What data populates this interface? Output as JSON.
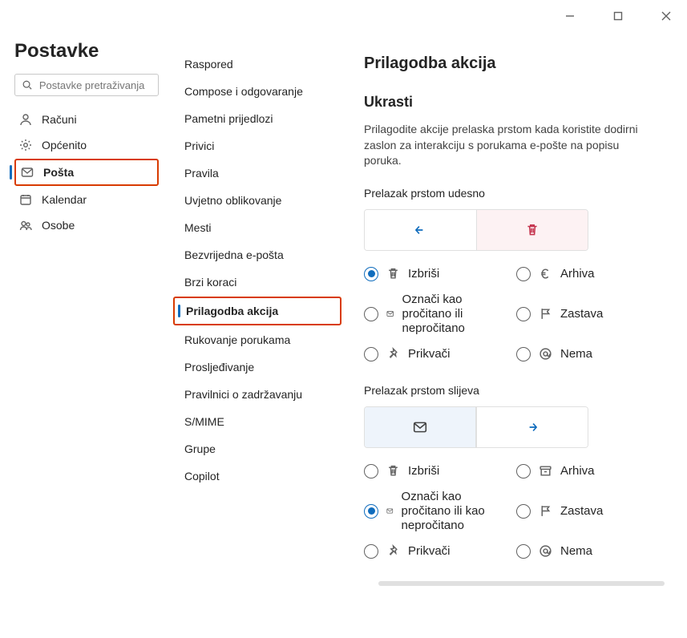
{
  "window": {
    "minimize": "–",
    "maximize": "▢",
    "close": "✕"
  },
  "sidebar": {
    "title": "Postavke",
    "search_placeholder": "Postavke pretraživanja",
    "items": [
      {
        "label": "Računi",
        "icon": "person"
      },
      {
        "label": "Općenito",
        "icon": "gear"
      },
      {
        "label": "Pošta",
        "icon": "mail",
        "selected": true,
        "callout": true
      },
      {
        "label": "Kalendar",
        "icon": "calendar"
      },
      {
        "label": "Osobe",
        "icon": "people"
      }
    ]
  },
  "subnav": {
    "items": [
      "Raspored",
      "Compose i odgovaranje",
      "Pametni prijedlozi",
      "Privici",
      "Pravila",
      "Uvjetno oblikovanje",
      "Mesti",
      "Bezvrijedna e-pošta",
      "Brzi koraci",
      "Prilagodba akcija",
      "Rukovanje porukama",
      "Prosljeđivanje",
      "Pravilnici o zadržavanju",
      "S/MIME",
      "Grupe",
      "Copilot"
    ],
    "selected_index": 9
  },
  "main": {
    "title": "Prilagodba akcija",
    "section_title": "Ukrasti",
    "description": "Prilagodite akcije prelaska prstom kada koristite dodirni zaslon za interakciju s porukama e-pošte na popisu poruka.",
    "swipe_right": {
      "label": "Prelazak prstom udesno",
      "preview": {
        "left_icon": "arrow-left",
        "right_icon": "trash",
        "right_bg": "pink"
      },
      "options": [
        {
          "icon": "trash",
          "label": "Izbriši",
          "selected": true
        },
        {
          "icon": "euro",
          "label": "Arhiva",
          "selected": false
        },
        {
          "icon": "mail",
          "label": "Označi kao pročitano ili nepročitano",
          "selected": false
        },
        {
          "icon": "flag",
          "label": "Zastava",
          "selected": false
        },
        {
          "icon": "pin",
          "label": "Prikvači",
          "selected": false
        },
        {
          "icon": "at",
          "label": "Nema",
          "selected": false
        }
      ]
    },
    "swipe_left": {
      "label": "Prelazak prstom slijeva",
      "preview": {
        "left_icon": "mail",
        "left_bg": "blue",
        "right_icon": "arrow-right"
      },
      "options": [
        {
          "icon": "trash",
          "label": "Izbriši",
          "selected": false
        },
        {
          "icon": "archive",
          "label": "Arhiva",
          "selected": false
        },
        {
          "icon": "mail",
          "label": "Označi kao pročitano ili kao nepročitano",
          "selected": true
        },
        {
          "icon": "flag",
          "label": "Zastava",
          "selected": false
        },
        {
          "icon": "pin",
          "label": "Prikvači",
          "selected": false
        },
        {
          "icon": "at",
          "label": "Nema",
          "selected": false
        }
      ]
    }
  }
}
